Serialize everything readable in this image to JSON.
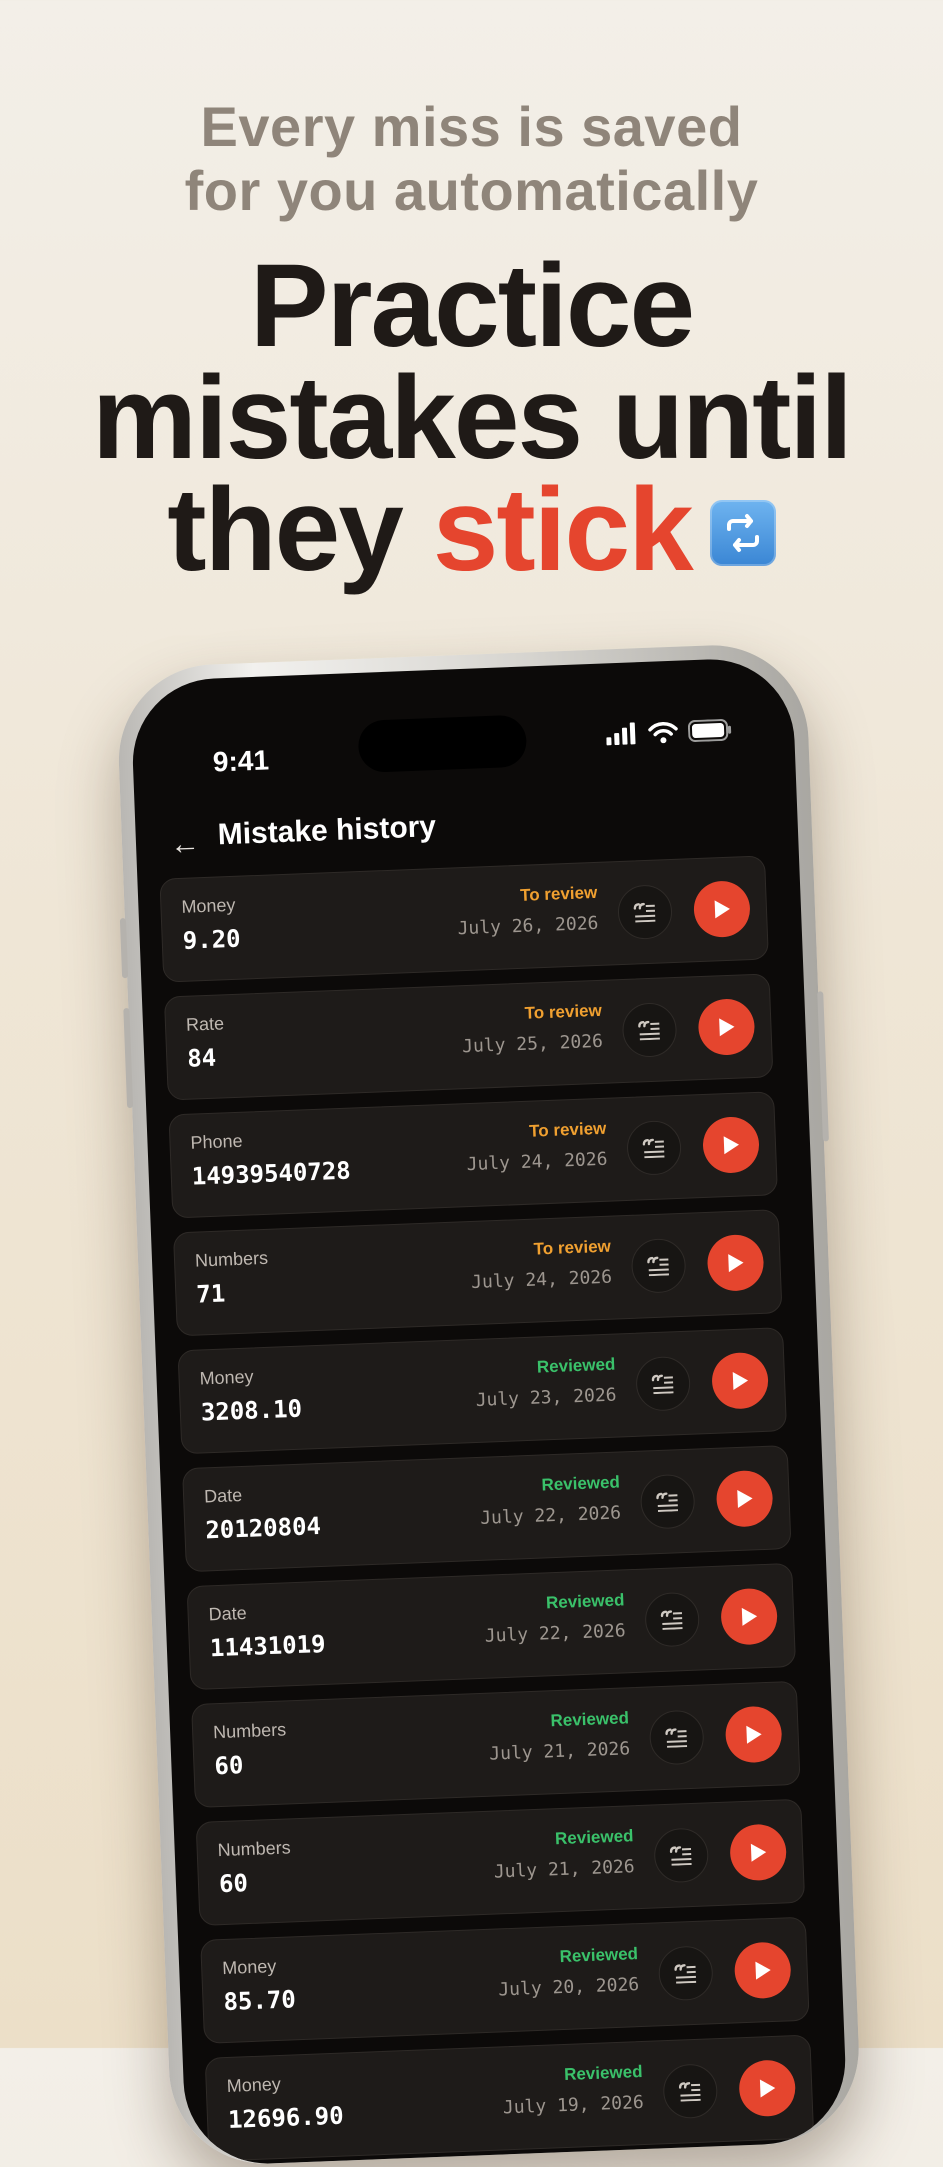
{
  "promo": {
    "subtitle_line1": "Every miss is saved",
    "subtitle_line2": "for you automatically",
    "headline_line1": "Practice",
    "headline_line2": "mistakes until",
    "headline_word": "they",
    "headline_accent": "stick",
    "accent_color": "#e5452e",
    "emoji_icon": "repeat-arrows-icon"
  },
  "status_bar": {
    "time": "9:41"
  },
  "nav": {
    "back_icon": "←",
    "title": "Mistake history"
  },
  "mistakes": [
    {
      "category": "Money",
      "value": "9.20",
      "status": "To review",
      "date": "July 26, 2026"
    },
    {
      "category": "Rate",
      "value": "84",
      "status": "To review",
      "date": "July 25, 2026"
    },
    {
      "category": "Phone",
      "value": "14939540728",
      "status": "To review",
      "date": "July 24, 2026"
    },
    {
      "category": "Numbers",
      "value": "71",
      "status": "To review",
      "date": "July 24, 2026"
    },
    {
      "category": "Money",
      "value": "3208.10",
      "status": "Reviewed",
      "date": "July 23, 2026"
    },
    {
      "category": "Date",
      "value": "20120804",
      "status": "Reviewed",
      "date": "July 22, 2026"
    },
    {
      "category": "Date",
      "value": "11431019",
      "status": "Reviewed",
      "date": "July 22, 2026"
    },
    {
      "category": "Numbers",
      "value": "60",
      "status": "Reviewed",
      "date": "July 21, 2026"
    },
    {
      "category": "Numbers",
      "value": "60",
      "status": "Reviewed",
      "date": "July 21, 2026"
    },
    {
      "category": "Money",
      "value": "85.70",
      "status": "Reviewed",
      "date": "July 20, 2026"
    },
    {
      "category": "Money",
      "value": "12696.90",
      "status": "Reviewed",
      "date": "July 19, 2026"
    }
  ],
  "colors": {
    "to_review": "#f0a030",
    "reviewed": "#3ac16a",
    "play": "#e5452e"
  }
}
